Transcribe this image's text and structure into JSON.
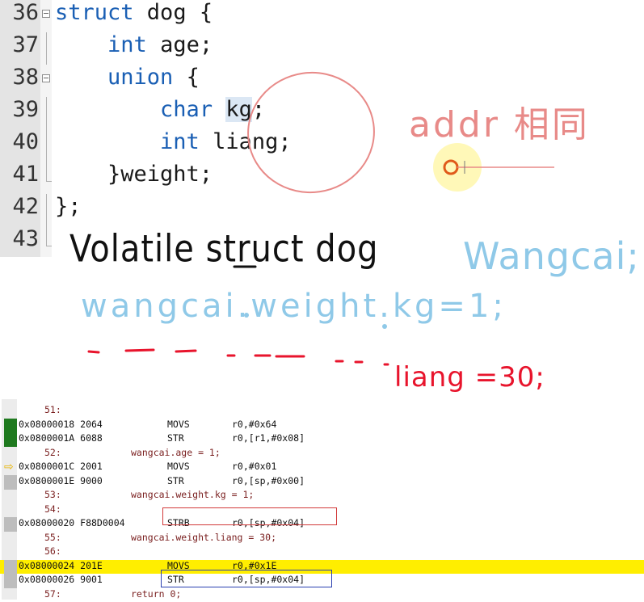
{
  "editor": {
    "lines": [
      {
        "num": "36",
        "tokens": [
          {
            "t": "struct",
            "kw": true
          },
          {
            "t": " dog {"
          }
        ]
      },
      {
        "num": "37",
        "tokens": [
          {
            "t": "    "
          },
          {
            "t": "int",
            "kw": true
          },
          {
            "t": " age;"
          }
        ]
      },
      {
        "num": "38",
        "tokens": [
          {
            "t": "    "
          },
          {
            "t": "union",
            "kw": true
          },
          {
            "t": " {"
          }
        ]
      },
      {
        "num": "39",
        "tokens": [
          {
            "t": "        "
          },
          {
            "t": "char",
            "kw": true
          },
          {
            "t": " "
          },
          {
            "t": "kg",
            "hl": true
          },
          {
            "t": ";"
          }
        ]
      },
      {
        "num": "40",
        "tokens": [
          {
            "t": "        "
          },
          {
            "t": "int",
            "kw": true
          },
          {
            "t": " liang;"
          }
        ]
      },
      {
        "num": "41",
        "tokens": [
          {
            "t": "    }weight;"
          }
        ]
      },
      {
        "num": "42",
        "tokens": [
          {
            "t": "};"
          }
        ]
      },
      {
        "num": "43",
        "tokens": []
      }
    ]
  },
  "handwriting": {
    "black_line": "Volatile struct dog",
    "blue_name": "Wangcai;",
    "blue_line": "wangcai.weight.kg=1;",
    "red_addr": "addr 相同",
    "red_liang": "liang =30;"
  },
  "colors": {
    "keyword": "#1a5fb4",
    "ink_black": "#111111",
    "ink_blue": "#8fc9e8",
    "ink_red_light": "#e88a88",
    "ink_red": "#e8142c",
    "current_line": "#ffee00",
    "breakpoint_green": "#1f7a1f"
  },
  "disasm": {
    "rows": [
      {
        "kind": "src",
        "num": "51:",
        "text": ""
      },
      {
        "kind": "asm",
        "mark": "green",
        "addr": "0x08000018 2064",
        "op": "MOVS",
        "args": "r0,#0x64"
      },
      {
        "kind": "asm",
        "mark": "green",
        "addr": "0x0800001A 6088",
        "op": "STR",
        "args": "r0,[r1,#0x08]"
      },
      {
        "kind": "src",
        "num": "52:",
        "text": "wangcai.age = 1;"
      },
      {
        "kind": "asm",
        "mark": "arrow",
        "addr": "0x0800001C 2001",
        "op": "MOVS",
        "args": "r0,#0x01"
      },
      {
        "kind": "asm",
        "mark": "gray",
        "addr": "0x0800001E 9000",
        "op": "STR",
        "args": "r0,[sp,#0x00]"
      },
      {
        "kind": "src",
        "num": "53:",
        "text": "wangcai.weight.kg = 1;"
      },
      {
        "kind": "src",
        "num": "54:",
        "text": ""
      },
      {
        "kind": "asm",
        "mark": "gray",
        "addr": "0x08000020 F88D0004",
        "op": "STRB",
        "args": "r0,[sp,#0x04]"
      },
      {
        "kind": "src",
        "num": "55:",
        "text": "wangcai.weight.liang = 30;"
      },
      {
        "kind": "src",
        "num": "56:",
        "text": ""
      },
      {
        "kind": "asm",
        "mark": "gray",
        "current": true,
        "addr": "0x08000024 201E",
        "op": "MOVS",
        "args": "r0,#0x1E"
      },
      {
        "kind": "asm",
        "mark": "gray",
        "addr": "0x08000026 9001",
        "op": "STR",
        "args": "r0,[sp,#0x04]"
      },
      {
        "kind": "src",
        "num": "57:",
        "text": "return 0;"
      }
    ]
  }
}
